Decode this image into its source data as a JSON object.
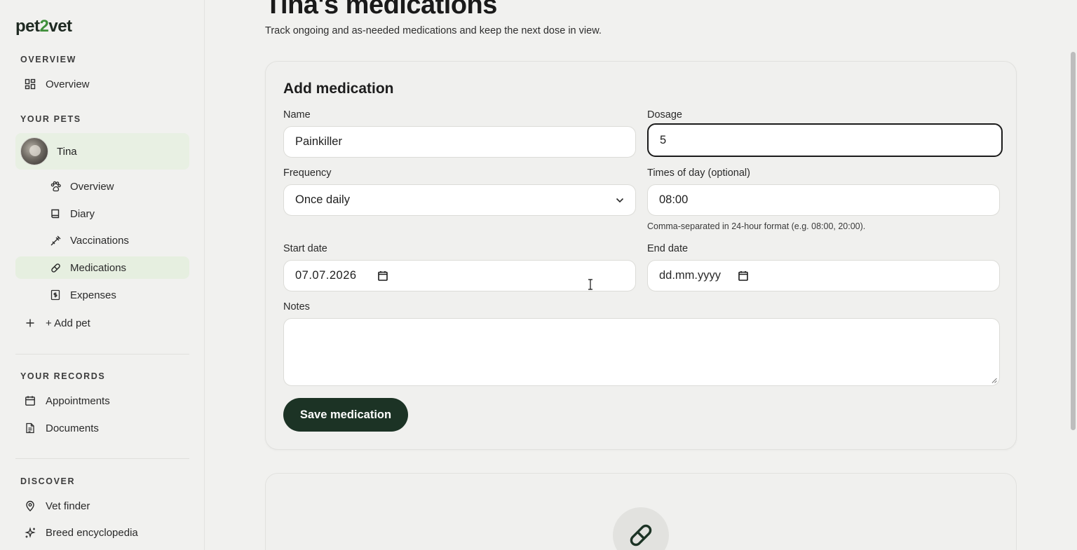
{
  "brand": {
    "logo_pre": "pet",
    "logo_num": "2",
    "logo_post": "vet"
  },
  "sidebar": {
    "overview_section": "OVERVIEW",
    "overview_item": "Overview",
    "pets_section": "YOUR PETS",
    "pet": {
      "name": "Tina"
    },
    "pet_items": [
      {
        "label": "Overview",
        "icon": "paw-icon"
      },
      {
        "label": "Diary",
        "icon": "book-icon"
      },
      {
        "label": "Vaccinations",
        "icon": "syringe-icon"
      },
      {
        "label": "Medications",
        "icon": "pill-icon",
        "active": true
      },
      {
        "label": "Expenses",
        "icon": "receipt-icon"
      }
    ],
    "add_pet": "+ Add pet",
    "records_section": "YOUR RECORDS",
    "records_items": [
      {
        "label": "Appointments",
        "icon": "calendar-icon"
      },
      {
        "label": "Documents",
        "icon": "document-icon"
      }
    ],
    "discover_section": "DISCOVER",
    "discover_items": [
      {
        "label": "Vet finder",
        "icon": "map-pin-icon"
      },
      {
        "label": "Breed encyclopedia",
        "icon": "sparkle-icon"
      }
    ]
  },
  "page": {
    "title": "Tina's medications",
    "subtitle": "Track ongoing and as-needed medications and keep the next dose in view."
  },
  "form": {
    "title": "Add medication",
    "name_label": "Name",
    "name_value": "Painkiller",
    "dosage_label": "Dosage",
    "dosage_value": "5",
    "frequency_label": "Frequency",
    "frequency_value": "Once daily",
    "times_label": "Times of day (optional)",
    "times_value": "08:00",
    "times_hint": "Comma-separated in 24-hour format (e.g. 08:00, 20:00).",
    "start_label": "Start date",
    "start_value": "07.07.2026",
    "end_label": "End date",
    "end_placeholder": "dd.mm.yyyy",
    "notes_label": "Notes",
    "notes_value": "",
    "save_label": "Save medication"
  },
  "colors": {
    "accent": "#1c3325",
    "active_bg": "#e6efe0",
    "brand_green": "#3f8f3a"
  }
}
